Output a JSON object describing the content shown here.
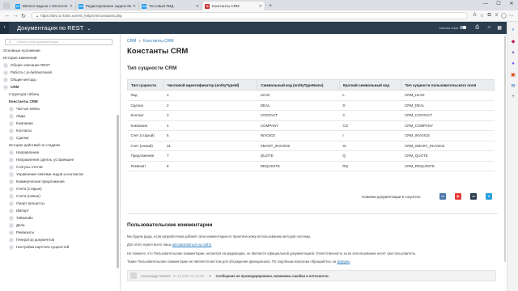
{
  "browser": {
    "tabs": [
      {
        "title": "Bitrix24 Задачи с MS Excel",
        "favicon": "24",
        "color": "#1d9bf0",
        "active": false
      },
      {
        "title": "Редактирование задачи № 2",
        "favicon": "24",
        "color": "#1d9bf0",
        "active": false
      },
      {
        "title": "Тестовый ЛИД",
        "favicon": "24",
        "color": "#1d9bf0",
        "active": false
      },
      {
        "title": "Константы CRM",
        "favicon": "⊙",
        "color": "#c9302c",
        "active": true
      }
    ],
    "new_tab": "+",
    "url": "https://dev.1c-bitrix.ru/rest_help/crm/constants.php",
    "window_controls": [
      "—",
      "☐",
      "✕"
    ]
  },
  "header": {
    "menu_icon": "›",
    "title": "Документация по REST",
    "chevron": "⌄",
    "theme_label": "Темная тема"
  },
  "sidebar": {
    "search_placeholder": "Поиск в этой документации",
    "items": [
      {
        "label": "Основные положения",
        "level": 0,
        "chevron": false
      },
      {
        "label": "История изменений",
        "level": 0,
        "chevron": false
      },
      {
        "label": "Общее описание REST",
        "level": 0,
        "chevron": true
      },
      {
        "label": "Работа с js-библиотекой",
        "level": 0,
        "chevron": true
      },
      {
        "label": "Общие методы",
        "level": 0,
        "chevron": true
      },
      {
        "label": "CRM",
        "level": 0,
        "chevron": true,
        "bold": true
      },
      {
        "label": "Структура таблиц",
        "level": 1,
        "chevron": false
      },
      {
        "label": "Константы CRM",
        "level": 1,
        "chevron": false,
        "active": true
      },
      {
        "label": "Частые кейсы",
        "level": 1,
        "chevron": true
      },
      {
        "label": "Лиды",
        "level": 1,
        "chevron": true
      },
      {
        "label": "Компании",
        "level": 1,
        "chevron": true
      },
      {
        "label": "Контакты",
        "level": 1,
        "chevron": true
      },
      {
        "label": "Сделки",
        "level": 1,
        "chevron": true
      },
      {
        "label": "История действий по стадиям",
        "level": 1,
        "chevron": false
      },
      {
        "label": "Направления",
        "level": 1,
        "chevron": true
      },
      {
        "label": "Направления сделок, устаревшее",
        "level": 1,
        "chevron": true
      },
      {
        "label": "Статусы счетов",
        "level": 1,
        "chevron": true
      },
      {
        "label": "Управление связями лидов и контактов",
        "level": 1,
        "chevron": true
      },
      {
        "label": "Коммерческие предложения",
        "level": 1,
        "chevron": true
      },
      {
        "label": "Счета (старые)",
        "level": 1,
        "chevron": true
      },
      {
        "label": "Счета (новые)",
        "level": 1,
        "chevron": true
      },
      {
        "label": "Смарт-процессы",
        "level": 1,
        "chevron": true
      },
      {
        "label": "Импорт",
        "level": 1,
        "chevron": true
      },
      {
        "label": "Таймлайн",
        "level": 1,
        "chevron": true
      },
      {
        "label": "Дела",
        "level": 1,
        "chevron": true
      },
      {
        "label": "Реквизиты",
        "level": 1,
        "chevron": true
      },
      {
        "label": "Генератор документов",
        "level": 1,
        "chevron": true
      },
      {
        "label": "Настройка карточек сущностей",
        "level": 1,
        "chevron": true
      }
    ]
  },
  "main": {
    "breadcrumbs": [
      "CRM",
      "Константы CRM"
    ],
    "title": "Константы CRM",
    "section_title": "Тип сущности CRM",
    "table": {
      "headers": [
        "Тип сущности",
        "Числовой идентификатор (entityTypeId)",
        "Символьный код (entityTypeName)",
        "Краткий символьный код",
        "Тип сущности пользовательского поля"
      ],
      "rows": [
        [
          "Лид",
          "1",
          "LEAD",
          "L",
          "CRM_LEAD"
        ],
        [
          "Сделка",
          "2",
          "DEAL",
          "D",
          "CRM_DEAL"
        ],
        [
          "Контакт",
          "3",
          "CONTACT",
          "C",
          "CRM_CONTACT"
        ],
        [
          "Компания",
          "4",
          "COMPANY",
          "CO",
          "CRM_COMPANY"
        ],
        [
          "Счет (старый)",
          "5",
          "INVOICE",
          "I",
          "CRM_INVOICE"
        ],
        [
          "Счет (новый)",
          "31",
          "SMART_INVOICE",
          "SI",
          "CRM_SMART_INVOICE"
        ],
        [
          "Предложение",
          "7",
          "QUOTE",
          "Q",
          "CRM_QUOTE"
        ],
        [
          "Реквизит",
          "8",
          "REQUISITE",
          "RQ",
          "CRM_REQUISITE"
        ]
      ]
    },
    "social": {
      "label": "Новинки документации в соцсетях:",
      "icons": [
        {
          "name": "vk-icon",
          "glyph": "vk",
          "color": "#4a76a8"
        },
        {
          "name": "youtube-icon",
          "glyph": "▶",
          "color": "#e53935"
        },
        {
          "name": "ok-icon",
          "glyph": "ok",
          "color": "#2b3d4f"
        },
        {
          "name": "telegram-icon",
          "glyph": "➤",
          "color": "#29a0db"
        }
      ]
    },
    "comments": {
      "title": "Пользовательские комментарии",
      "p1": "Мы будем рады, если разработчики добавят свои комментарии по практическому использованию методов системы.",
      "p2_text": "Для этого нужно всего лишь",
      "p2_link": "авторизоваться на сайте",
      "p3": "Но помните, что Пользовательские комментарии, несмотря на модерацию, не являются официальной документацией. Ответственность за их использование несет сам пользователь.",
      "p4_text": "Также Пользовательские комментарии не являются местом для обсуждения функционала. По подобным вопросам обращайтесь на",
      "p4_link": "форумы",
      "comment": {
        "author": "Александр Поволя",
        "date": "01.10.2022 12:31:55",
        "system": "Сообщение не промодерировано, возможны ошибки и неточности."
      }
    }
  }
}
